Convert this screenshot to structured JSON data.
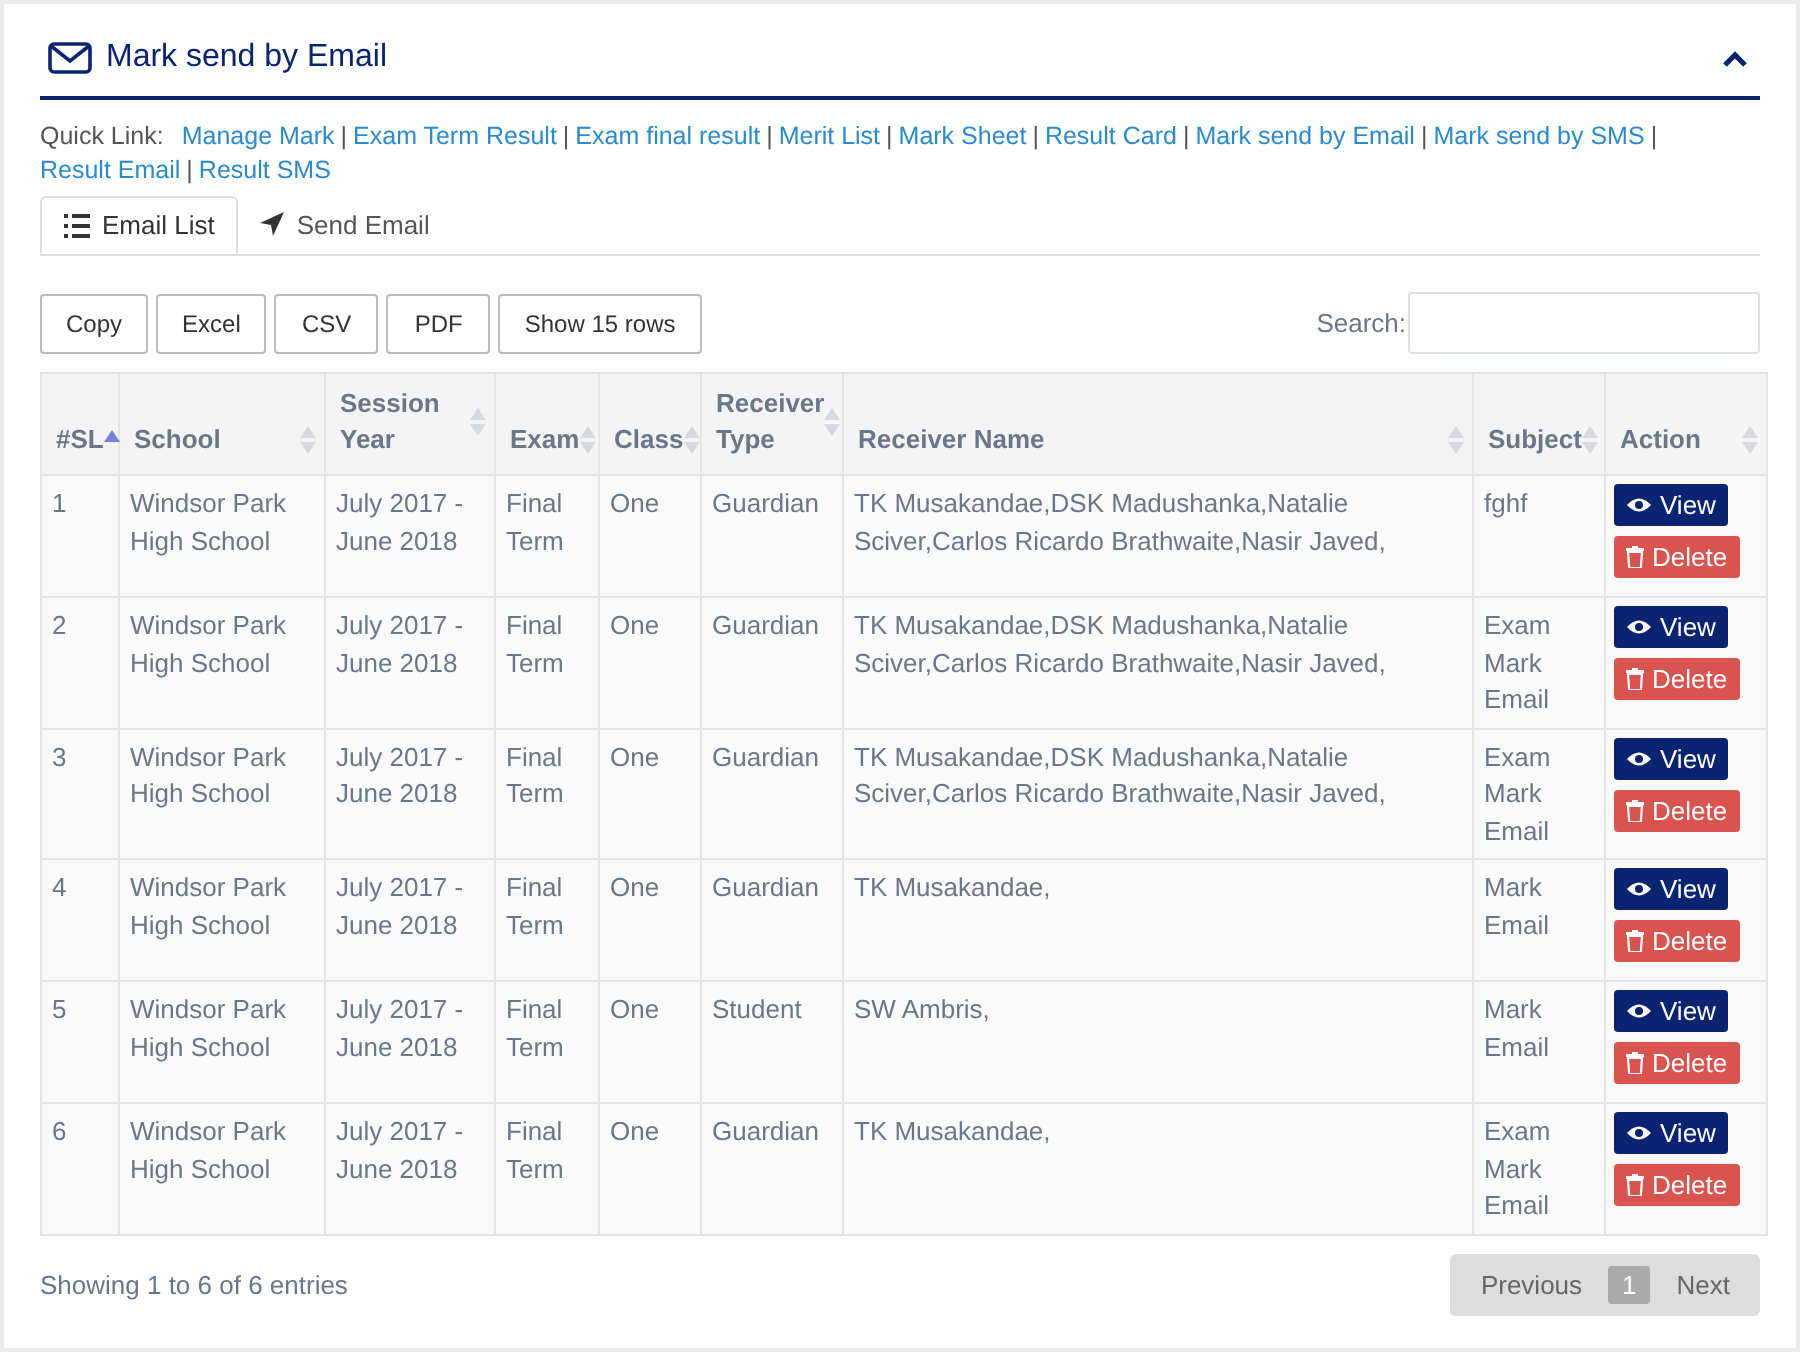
{
  "panel": {
    "title": "Mark send by Email"
  },
  "quick_links": {
    "label": "Quick Link:",
    "separator": "|",
    "links": [
      "Manage Mark",
      "Exam Term Result",
      "Exam final result",
      "Merit List",
      "Mark Sheet",
      "Result Card",
      "Mark send by Email",
      "Mark send by SMS",
      "Result Email",
      "Result SMS"
    ]
  },
  "tabs": [
    {
      "label": "Email List",
      "selected": true
    },
    {
      "label": "Send Email",
      "selected": false
    }
  ],
  "export_buttons": [
    "Copy",
    "Excel",
    "CSV",
    "PDF",
    "Show 15 rows"
  ],
  "search": {
    "label": "Search:"
  },
  "table": {
    "columns": [
      {
        "label": "#SL",
        "sorted": true
      },
      {
        "label": "School",
        "sorted": false
      },
      {
        "label": "Session Year",
        "sorted": false
      },
      {
        "label": "Exam",
        "sorted": false
      },
      {
        "label": "Class",
        "sorted": false
      },
      {
        "label": "Receiver Type",
        "sorted": false
      },
      {
        "label": "Receiver Name",
        "sorted": false
      },
      {
        "label": "Subject",
        "sorted": false
      },
      {
        "label": "Action",
        "sorted": false
      }
    ],
    "rows": [
      {
        "cells": [
          "1",
          "Windsor Park High School",
          "July 2017 - June 2018",
          "Final Term",
          "One",
          "Guardian",
          "TK Musakandae,DSK Madushanka,Natalie Sciver,Carlos Ricardo Brathwaite,Nasir Javed,",
          "fghf"
        ],
        "actions": [
          "View",
          "Delete"
        ]
      },
      {
        "cells": [
          "2",
          "Windsor Park High School",
          "July 2017 - June 2018",
          "Final Term",
          "One",
          "Guardian",
          "TK Musakandae,DSK Madushanka,Natalie Sciver,Carlos Ricardo Brathwaite,Nasir Javed,",
          "Exam Mark Email"
        ],
        "actions": [
          "View",
          "Delete"
        ]
      },
      {
        "cells": [
          "3",
          "Windsor Park High School",
          "July 2017 - June 2018",
          "Final Term",
          "One",
          "Guardian",
          "TK Musakandae,DSK Madushanka,Natalie Sciver,Carlos Ricardo Brathwaite,Nasir Javed,",
          "Exam Mark Email"
        ],
        "actions": [
          "View",
          "Delete"
        ]
      },
      {
        "cells": [
          "4",
          "Windsor Park High School",
          "July 2017 - June 2018",
          "Final Term",
          "One",
          "Guardian",
          "TK Musakandae,",
          "Mark Email"
        ],
        "actions": [
          "View",
          "Delete"
        ]
      },
      {
        "cells": [
          "5",
          "Windsor Park High School",
          "July 2017 - June 2018",
          "Final Term",
          "One",
          "Student",
          "SW Ambris,",
          "Mark Email"
        ],
        "actions": [
          "View",
          "Delete"
        ]
      },
      {
        "cells": [
          "6",
          "Windsor Park High School",
          "July 2017 - June 2018",
          "Final Term",
          "One",
          "Guardian",
          "TK Musakandae,",
          "Exam Mark Email"
        ],
        "actions": [
          "View",
          "Delete"
        ]
      }
    ]
  },
  "footer": {
    "info": "Showing 1 to 6 of 6 entries",
    "pagination": [
      {
        "label": "Previous",
        "selected": false
      },
      {
        "label": "1",
        "selected": true
      },
      {
        "label": "Next",
        "selected": false
      }
    ]
  }
}
